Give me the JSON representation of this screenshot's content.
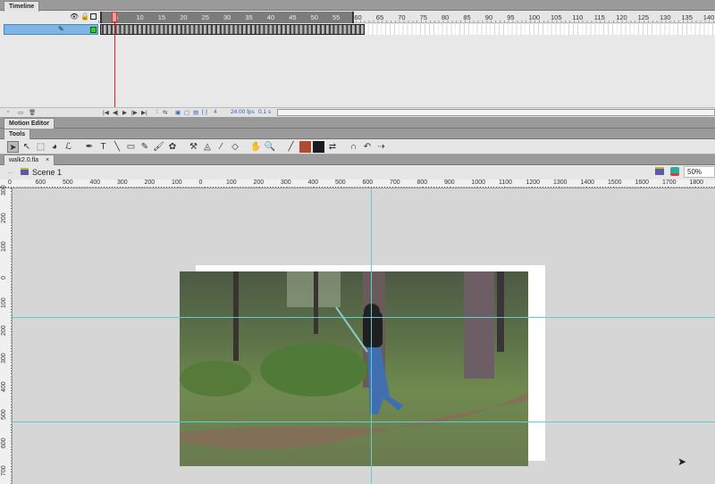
{
  "timeline": {
    "title": "Timeline",
    "frame_labels": [
      "5",
      "10",
      "15",
      "20",
      "25",
      "30",
      "35",
      "40",
      "45",
      "50",
      "55",
      "60",
      "65",
      "70",
      "75",
      "80",
      "85",
      "90",
      "95",
      "100",
      "105",
      "110",
      "115",
      "120",
      "125",
      "130",
      "135",
      "140"
    ],
    "current_frame": "4",
    "fps": "24.00 fps",
    "elapsed": "0.1 s"
  },
  "motion_editor": {
    "title": "Motion Editor"
  },
  "tools": {
    "title": "Tools",
    "items": [
      {
        "name": "selection-tool",
        "glyph": "➤"
      },
      {
        "name": "subselection-tool",
        "glyph": "↖"
      },
      {
        "name": "free-transform-tool",
        "glyph": "⬚"
      },
      {
        "name": "3d-rotation-tool",
        "glyph": "◕"
      },
      {
        "name": "lasso-tool",
        "glyph": "ℒ"
      },
      {
        "name": "pen-tool",
        "glyph": "✒"
      },
      {
        "name": "text-tool",
        "glyph": "T"
      },
      {
        "name": "line-tool",
        "glyph": "╲"
      },
      {
        "name": "rectangle-tool",
        "glyph": "▭"
      },
      {
        "name": "pencil-tool",
        "glyph": "✎"
      },
      {
        "name": "brush-tool",
        "glyph": "🖌"
      },
      {
        "name": "deco-tool",
        "glyph": "✿"
      },
      {
        "name": "bone-tool",
        "glyph": "⚒"
      },
      {
        "name": "paint-bucket-tool",
        "glyph": "◬"
      },
      {
        "name": "eyedropper-tool",
        "glyph": "⁄"
      },
      {
        "name": "eraser-tool",
        "glyph": "◇"
      },
      {
        "name": "hand-tool",
        "glyph": "✋"
      },
      {
        "name": "zoom-tool",
        "glyph": "🔍"
      },
      {
        "name": "stroke-color",
        "glyph": "╱"
      },
      {
        "name": "fill-color",
        "glyph": "◆"
      },
      {
        "name": "black-white-swatch",
        "glyph": "◧"
      },
      {
        "name": "swap-colors",
        "glyph": "⇄"
      },
      {
        "name": "snap-to-objects",
        "glyph": "∩"
      },
      {
        "name": "smooth",
        "glyph": "↶"
      },
      {
        "name": "straighten",
        "glyph": "⇢"
      }
    ]
  },
  "colors": {
    "stroke": "#333333",
    "fill": "#b04a30",
    "fill_swatch": "#1a1a22",
    "guide": "#5ccfd4"
  },
  "document": {
    "tab": "walk2.0.fla",
    "close": "×",
    "scene": "Scene 1",
    "zoom": "50%"
  },
  "rulers": {
    "horizontal": [
      "0",
      "600",
      "500",
      "400",
      "300",
      "200",
      "100",
      "0",
      "100",
      "200",
      "300",
      "400",
      "500",
      "600",
      "700",
      "800",
      "900",
      "1000",
      "1100",
      "1200",
      "1300",
      "1400",
      "1500",
      "1600",
      "1700",
      "1800"
    ],
    "vertical": [
      "300",
      "200",
      "100",
      "0",
      "100",
      "200",
      "300",
      "400",
      "500",
      "600",
      "700"
    ]
  }
}
